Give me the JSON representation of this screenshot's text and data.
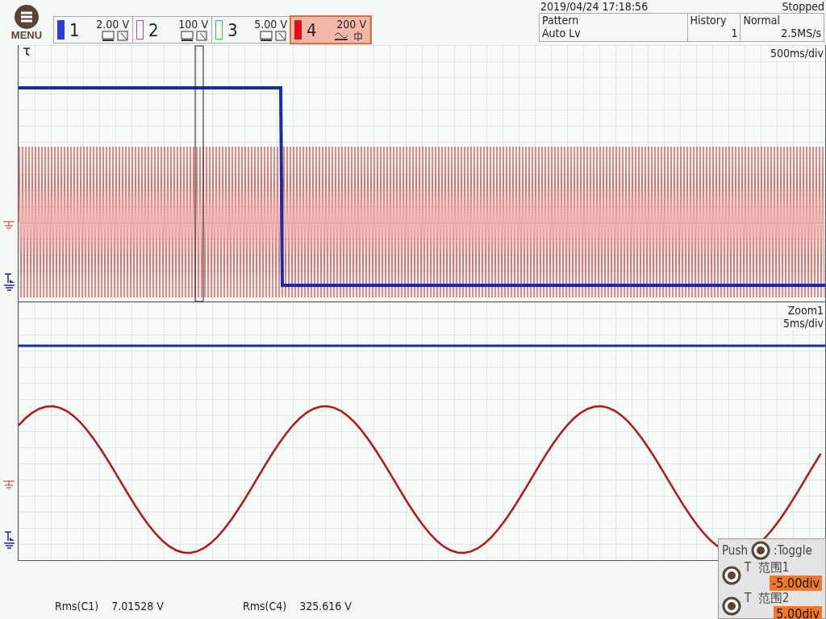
{
  "menu": {
    "label": "MENU"
  },
  "channels": [
    {
      "number": "1",
      "scale": "2.00 V",
      "color": "#2b3be0",
      "enabled": true,
      "selected": false,
      "kind": "dc"
    },
    {
      "number": "2",
      "scale": "100 V",
      "color": "#c03cc8",
      "enabled": false,
      "selected": false,
      "kind": "dc"
    },
    {
      "number": "3",
      "scale": "5.00 V",
      "color": "#3cc050",
      "enabled": false,
      "selected": false,
      "kind": "dc"
    },
    {
      "number": "4",
      "scale": "200 V",
      "color": "#e01010",
      "enabled": true,
      "selected": true,
      "kind": "ac"
    }
  ],
  "datetime": "2019/04/24 17:18:56",
  "run_state": "Stopped",
  "trigger": {
    "type": "Pattern",
    "level": "Auto Lv"
  },
  "history": {
    "label": "History",
    "value": "1"
  },
  "acquisition": {
    "mode": "Normal",
    "rate": "2.5MS/s"
  },
  "main_panel": {
    "timebase": "500ms/div"
  },
  "zoom_panel": {
    "title": "Zoom1",
    "timebase": "5ms/div"
  },
  "measurements": [
    {
      "label": "Rms(C1)",
      "value": "7.01528 V"
    },
    {
      "label": "Rms(C4)",
      "value": "325.616 V"
    }
  ],
  "toggle_popup": {
    "push": "Push",
    "toggle": ":Toggle",
    "items": [
      {
        "label": "T  范围1",
        "value": "-5.00div"
      },
      {
        "label": "T  范围2",
        "value": "5.00div"
      }
    ]
  }
}
